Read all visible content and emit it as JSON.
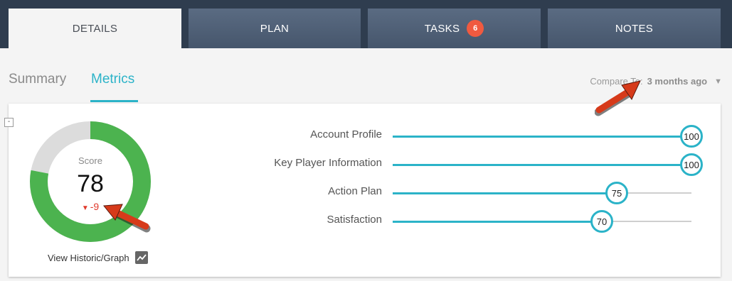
{
  "tabs": [
    {
      "label": "DETAILS",
      "active": true
    },
    {
      "label": "PLAN",
      "active": false
    },
    {
      "label": "TASKS",
      "active": false,
      "badge": "6"
    },
    {
      "label": "NOTES",
      "active": false
    }
  ],
  "subtabs": [
    {
      "label": "Summary",
      "active": false
    },
    {
      "label": "Metrics",
      "active": true
    }
  ],
  "compare": {
    "label": "Compare To:",
    "value": "3 months ago",
    "caret_icon": "triangle-down-icon"
  },
  "collapse_label": "-",
  "score": {
    "label": "Score",
    "value": "78",
    "change": "-9",
    "change_icon": "triangle-down-icon",
    "fraction": 0.78
  },
  "historic": {
    "label": "View Historic/Graph",
    "icon": "line-chart-icon"
  },
  "metrics": [
    {
      "label": "Account Profile",
      "value": "100"
    },
    {
      "label": "Key Player Information",
      "value": "100"
    },
    {
      "label": "Action Plan",
      "value": "75"
    },
    {
      "label": "Satisfaction",
      "value": "70"
    }
  ],
  "colors": {
    "tab_bar": "#2f3d4f",
    "accent": "#2bb3c8",
    "donut_fill": "#4cb34f",
    "donut_rest": "#dcdcdc",
    "badge": "#f05a40",
    "negative": "#e0392b",
    "annotation_arrow": "#d63a1a"
  }
}
